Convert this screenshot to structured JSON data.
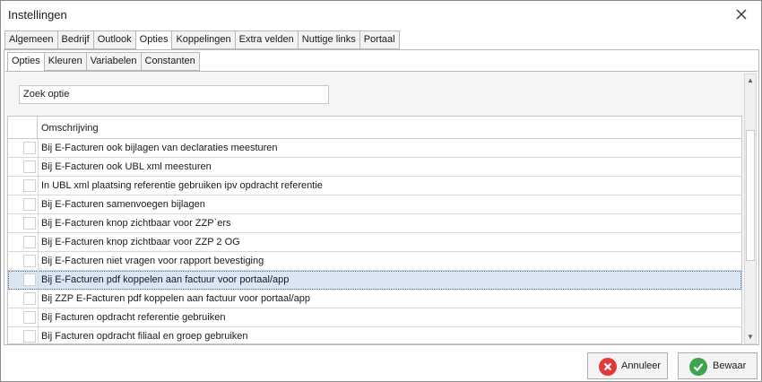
{
  "window": {
    "title": "Instellingen"
  },
  "main_tabs": [
    "Algemeen",
    "Bedrijf",
    "Outlook",
    "Opties",
    "Koppelingen",
    "Extra velden",
    "Nuttige links",
    "Portaal"
  ],
  "main_tabs_active": "Opties",
  "sub_tabs": [
    "Opties",
    "Kleuren",
    "Variabelen",
    "Constanten"
  ],
  "sub_tabs_active": "Opties",
  "search": {
    "value": "Zoek optie"
  },
  "grid": {
    "column_header": "Omschrijving",
    "rows": [
      {
        "label": "Bij E-Facturen ook bijlagen van declaraties meesturen",
        "checked": false,
        "selected": false
      },
      {
        "label": "Bij E-Facturen ook UBL xml meesturen",
        "checked": false,
        "selected": false
      },
      {
        "label": "In UBL xml plaatsing referentie gebruiken ipv opdracht referentie",
        "checked": false,
        "selected": false
      },
      {
        "label": "Bij E-Facturen samenvoegen bijlagen",
        "checked": false,
        "selected": false
      },
      {
        "label": "Bij E-Facturen knop zichtbaar voor ZZP`ers",
        "checked": false,
        "selected": false
      },
      {
        "label": "Bij E-Facturen knop zichtbaar voor ZZP 2 OG",
        "checked": false,
        "selected": false
      },
      {
        "label": "Bij E-Facturen niet vragen voor rapport bevestiging",
        "checked": false,
        "selected": false
      },
      {
        "label": "Bij E-Facturen pdf koppelen aan factuur voor portaal/app",
        "checked": false,
        "selected": true
      },
      {
        "label": "Bij ZZP E-Facturen pdf koppelen aan factuur voor portaal/app",
        "checked": false,
        "selected": false
      },
      {
        "label": "Bij Facturen opdracht referentie gebruiken",
        "checked": false,
        "selected": false
      },
      {
        "label": "Bij Facturen opdracht filiaal en groep gebruiken",
        "checked": false,
        "selected": false
      }
    ]
  },
  "buttons": {
    "cancel": "Annuleer",
    "save": "Bewaar"
  },
  "icons": {
    "close": "close-icon",
    "cancel": "cancel-icon",
    "save": "check-icon",
    "scroll_up": "arrow-up-icon",
    "scroll_down": "arrow-down-icon"
  },
  "colors": {
    "selected_row": "#dbe6f4",
    "cancel_icon": "#e03a3a",
    "save_icon": "#3fa34d"
  }
}
